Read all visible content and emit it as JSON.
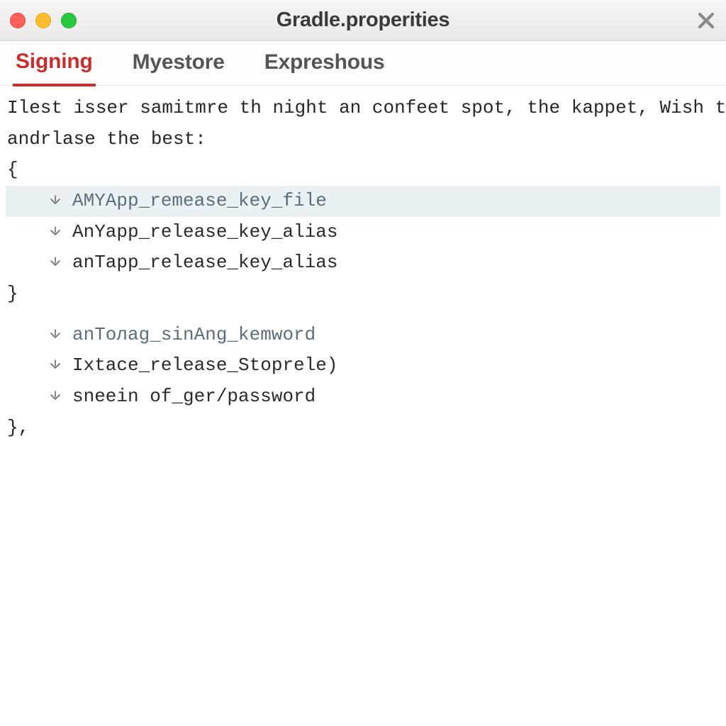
{
  "window": {
    "title": "Gradle.properities"
  },
  "tabs": [
    {
      "label": "Signing",
      "active": true
    },
    {
      "label": "Myestore",
      "active": false
    },
    {
      "label": "Expreshous",
      "active": false
    }
  ],
  "editor": {
    "intro_line1": "Ilest isser samitmre th night an confeet spot, the kappet, Wish that",
    "intro_line2": "andrlase the best:",
    "open_brace": "{",
    "props_a": [
      "AMYApp_remease_key_file",
      "AnYapp_release_key_alias",
      "anTapp_release_key_alias"
    ],
    "close_brace": "}",
    "props_b": [
      "anToлag_sinAng_kemword",
      "Ixtace_release_Stoprele)",
      "sneein of_ger/password"
    ],
    "close_brace2": "},"
  }
}
